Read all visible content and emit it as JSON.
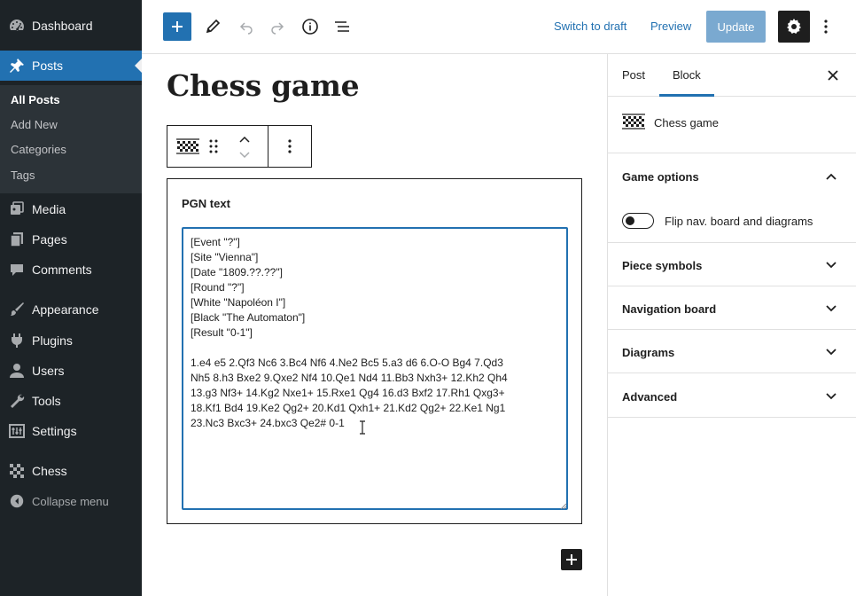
{
  "admin_menu": {
    "items": [
      {
        "label": "Dashboard",
        "icon": "dashboard-icon"
      },
      {
        "label": "Posts",
        "icon": "pin-icon"
      },
      {
        "label": "Media",
        "icon": "media-icon"
      },
      {
        "label": "Pages",
        "icon": "pages-icon"
      },
      {
        "label": "Comments",
        "icon": "comments-icon"
      },
      {
        "label": "Appearance",
        "icon": "paintbrush-icon"
      },
      {
        "label": "Plugins",
        "icon": "plugins-icon"
      },
      {
        "label": "Users",
        "icon": "users-icon"
      },
      {
        "label": "Tools",
        "icon": "wrench-icon"
      },
      {
        "label": "Settings",
        "icon": "settings-icon"
      },
      {
        "label": "Chess",
        "icon": "chess-icon"
      }
    ],
    "posts_submenu": [
      "All Posts",
      "Add New",
      "Categories",
      "Tags"
    ],
    "collapse_label": "Collapse menu"
  },
  "header": {
    "switch_to_draft": "Switch to draft",
    "preview": "Preview",
    "update": "Update"
  },
  "post": {
    "title": "Chess game"
  },
  "block": {
    "pgn_label": "PGN text",
    "pgn_text": "[Event \"?\"]\n[Site \"Vienna\"]\n[Date \"1809.??.??\"]\n[Round \"?\"]\n[White \"Napoléon I\"]\n[Black \"The Automaton\"]\n[Result \"0-1\"]\n\n1.e4 e5 2.Qf3 Nc6 3.Bc4 Nf6 4.Ne2 Bc5 5.a3 d6 6.O-O Bg4 7.Qd3\nNh5 8.h3 Bxe2 9.Qxe2 Nf4 10.Qe1 Nd4 11.Bb3 Nxh3+ 12.Kh2 Qh4\n13.g3 Nf3+ 14.Kg2 Nxe1+ 15.Rxe1 Qg4 16.d3 Bxf2 17.Rh1 Qxg3+\n18.Kf1 Bd4 19.Ke2 Qg2+ 20.Kd1 Qxh1+ 21.Kd2 Qg2+ 22.Ke1 Ng1\n23.Nc3 Bxc3+ 24.bxc3 Qe2# 0-1"
  },
  "settings_sidebar": {
    "tabs": [
      "Post",
      "Block"
    ],
    "active_tab": "Block",
    "block_name": "Chess game",
    "panels": [
      {
        "title": "Game options",
        "expanded": true
      },
      {
        "title": "Piece symbols",
        "expanded": false
      },
      {
        "title": "Navigation board",
        "expanded": false
      },
      {
        "title": "Diagrams",
        "expanded": false
      },
      {
        "title": "Advanced",
        "expanded": false
      }
    ],
    "flip_toggle_label": "Flip nav. board and diagrams",
    "flip_toggle_on": false
  },
  "colors": {
    "accent": "#2271b1",
    "sidebar_bg": "#1d2327",
    "submenu_bg": "#2c3338",
    "dark": "#1e1e1e"
  }
}
